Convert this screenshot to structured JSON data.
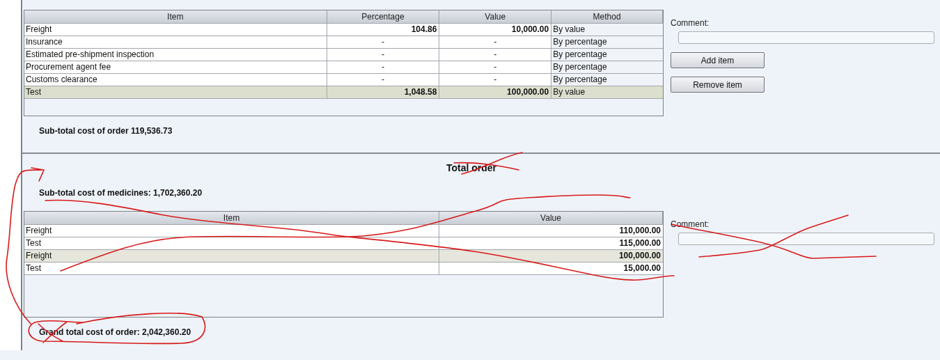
{
  "charges_table": {
    "columns": [
      "Item",
      "Percentage",
      "Value",
      "Method"
    ],
    "rows": [
      {
        "item": "Freight",
        "percentage": "104.86",
        "value": "10,000.00",
        "method": "By value",
        "selected": false
      },
      {
        "item": "Insurance",
        "percentage": "-",
        "value": "-",
        "method": "By percentage",
        "selected": false
      },
      {
        "item": "Estimated pre-shipment inspection",
        "percentage": "-",
        "value": "-",
        "method": "By percentage",
        "selected": false
      },
      {
        "item": "Procurement agent fee",
        "percentage": "-",
        "value": "-",
        "method": "By percentage",
        "selected": false
      },
      {
        "item": "Customs clearance",
        "percentage": "-",
        "value": "-",
        "method": "By percentage",
        "selected": false
      },
      {
        "item": "Test",
        "percentage": "1,048.58",
        "value": "100,000.00",
        "method": "By value",
        "selected": true
      }
    ]
  },
  "charges_comment": {
    "label": "Comment:"
  },
  "buttons": [
    "Add item",
    "Remove item"
  ],
  "subtotal_order": "Sub-total cost of order 119,536.73",
  "total_section": {
    "title": "Total order",
    "subtotal_medicines": "Sub-total cost of medicines: 1,702,360.20",
    "table": {
      "columns": [
        "Item",
        "Value"
      ],
      "rows": [
        {
          "item": "Freight",
          "value": "110,000.00",
          "selected": false
        },
        {
          "item": "Test",
          "value": "115,000.00",
          "selected": false
        },
        {
          "item": "Freight",
          "value": "100,000.00",
          "selected": true
        },
        {
          "item": "Test",
          "value": "15,000.00",
          "selected": false
        }
      ]
    },
    "comment": {
      "label": "Comment:"
    },
    "grand_total": "Grand total cost of order: 2,042,360.20"
  }
}
